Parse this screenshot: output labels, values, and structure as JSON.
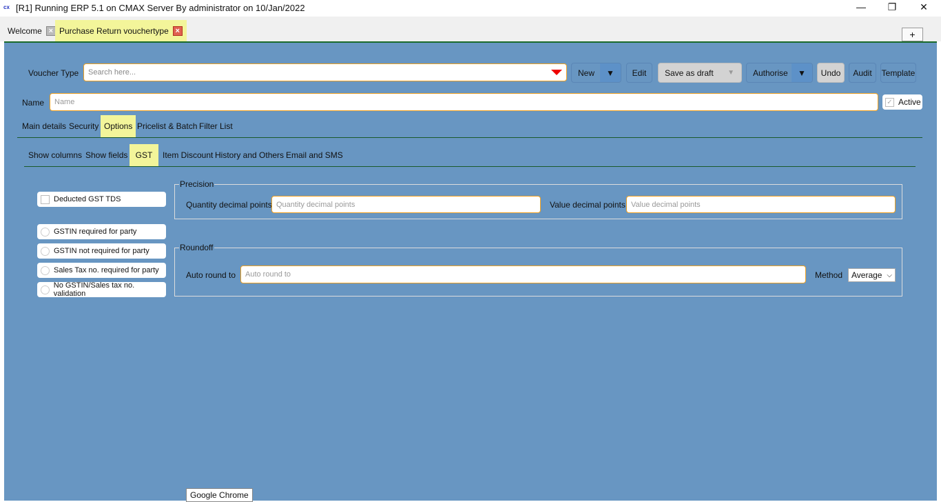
{
  "window": {
    "title": "[R1] Running ERP 5.1 on CMAX Server By administrator on 10/Jan/2022",
    "logo": "cx"
  },
  "tabs": [
    {
      "label": "Welcome"
    },
    {
      "label": "Purchase Return vouchertype"
    }
  ],
  "add_tab": "+",
  "toolbar": {
    "voucher_type_label": "Voucher Type",
    "search_placeholder": "Search here...",
    "new": "New",
    "edit": "Edit",
    "save_as_draft": "Save as draft",
    "authorise": "Authorise",
    "undo": "Undo",
    "audit": "Audit",
    "template": "Template"
  },
  "name_row": {
    "label": "Name",
    "placeholder": "Name",
    "active_label": "Active",
    "active_checked": true
  },
  "main_tabs": [
    "Main details",
    "Security",
    "Options",
    "Pricelist & Batch",
    "Filter List"
  ],
  "main_tabs_selected": "Options",
  "sub_tabs": [
    "Show columns",
    "Show fields",
    "GST",
    "Item Discount",
    "History and Others",
    "Email and SMS"
  ],
  "sub_tabs_selected": "GST",
  "gst": {
    "deducted_gst_tds": {
      "label": "Deducted GST TDS",
      "checked": false
    },
    "radios": [
      {
        "label": "GSTIN required for party"
      },
      {
        "label": "GSTIN not required for party"
      },
      {
        "label": "Sales Tax no. required for party"
      },
      {
        "label": "No GSTIN/Sales tax no. validation"
      }
    ],
    "precision": {
      "title": "Precision",
      "qty_label": "Quantity decimal points",
      "qty_placeholder": "Quantity decimal points",
      "value_label": "Value decimal points",
      "value_placeholder": "Value decimal points"
    },
    "roundoff": {
      "title": "Roundoff",
      "auto_label": "Auto round to",
      "auto_placeholder": "Auto round to",
      "method_label": "Method",
      "method_value": "Average"
    }
  },
  "tooltip": "Google Chrome",
  "colors": {
    "background": "#6896c2",
    "highlight": "#f3f59a",
    "input_border": "#f0a020"
  }
}
